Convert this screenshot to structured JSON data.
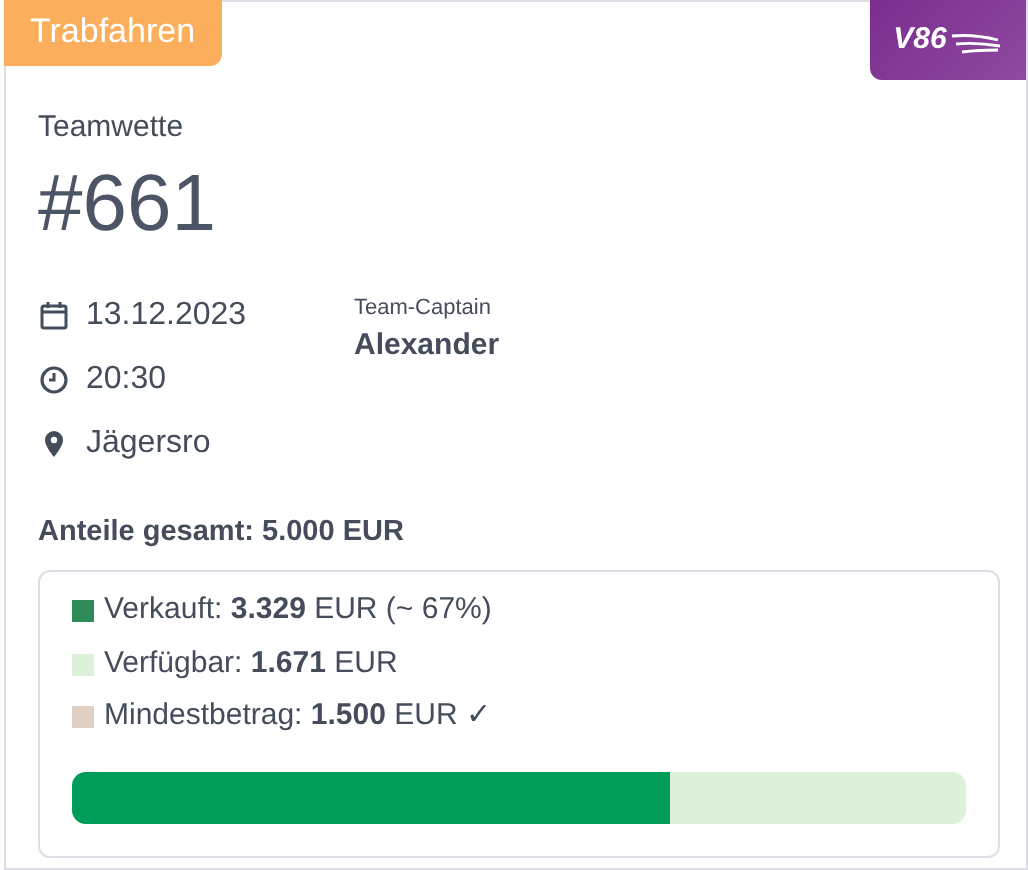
{
  "category_badge": "Trabfahren",
  "logo": {
    "text": "V86"
  },
  "subtitle": "Teamwette",
  "title": "#661",
  "details": [
    {
      "kind": "date",
      "text": "13.12.2023"
    },
    {
      "kind": "time",
      "text": "20:30"
    },
    {
      "kind": "location",
      "text": "Jägersro"
    }
  ],
  "captain": {
    "label": "Team-Captain",
    "name": "Alexander"
  },
  "total": "Anteile gesamt: 5.000 EUR",
  "legend": [
    {
      "text": "Verkauft: **3.329** EUR (~ 67%)",
      "color": "#2e8b57"
    },
    {
      "text": "Verfügbar: **1.671** EUR",
      "color": "#ddf0da"
    },
    {
      "text": "Mindestbetrag: **1.500** EUR ✓",
      "color": "#e0d0c4"
    }
  ],
  "progress": {
    "level": 0.67
  }
}
